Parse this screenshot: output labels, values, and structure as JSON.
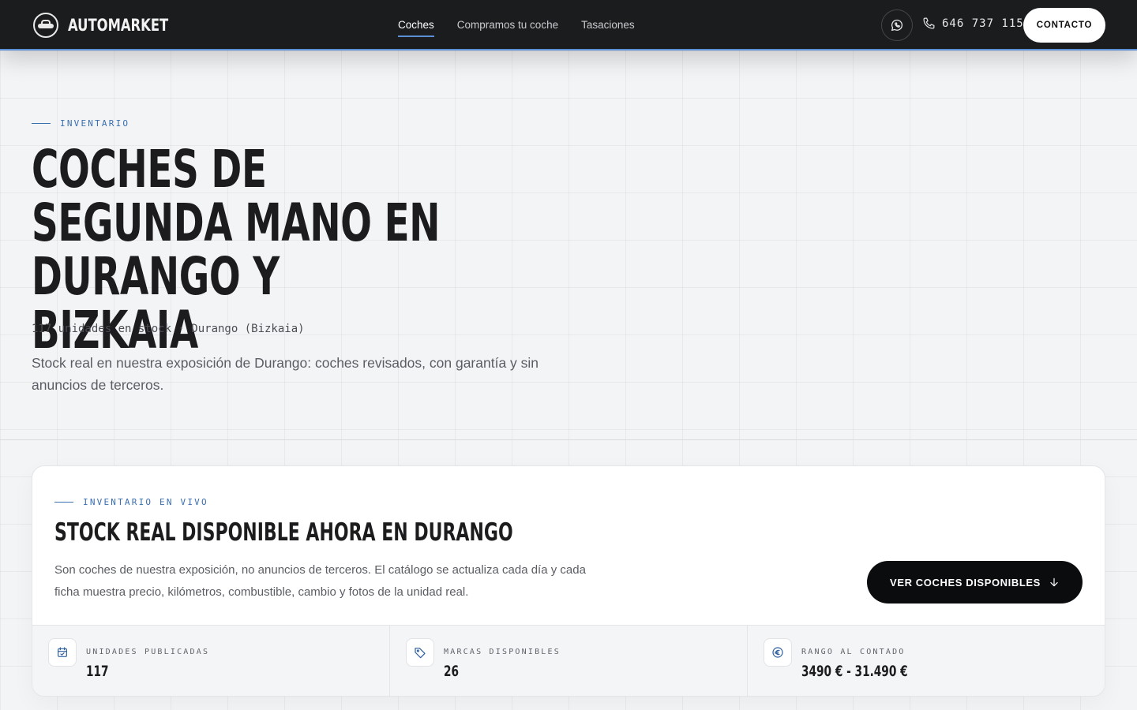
{
  "header": {
    "brand": "AUTOMARKET",
    "nav": [
      {
        "label": "Coches",
        "active": true
      },
      {
        "label": "Compramos tu coche",
        "active": false
      },
      {
        "label": "Tasaciones",
        "active": false
      }
    ],
    "phone": "646 737 115",
    "contact_label": "CONTACTO",
    "accent_color": "#5b8fd6"
  },
  "hero": {
    "eyebrow": "INVENTARIO",
    "title_lines": [
      "COCHES DE",
      "SEGUNDA MANO EN",
      "DURANGO Y BIZKAIA"
    ],
    "meta": "117 unidades en stock · Durango (Bizkaia)",
    "description": "Stock real en nuestra exposición de Durango: coches revisados, con garantía y sin anuncios de terceros."
  },
  "inventory": {
    "eyebrow": "INVENTARIO EN VIVO",
    "title": "STOCK REAL DISPONIBLE AHORA EN DURANGO",
    "description": "Son coches de nuestra exposición, no anuncios de terceros. El catálogo se actualiza cada día y cada ficha muestra precio, kilómetros, combustible, cambio y fotos de la unidad real.",
    "cta_label": "VER COCHES DISPONIBLES",
    "stats": [
      {
        "icon": "calendar-icon",
        "label": "UNIDADES PUBLICADAS",
        "value": "117"
      },
      {
        "icon": "tag-icon",
        "label": "MARCAS DISPONIBLES",
        "value": "26"
      },
      {
        "icon": "euro-icon",
        "label": "RANGO AL CONTADO",
        "value": "3490 € - 31.490 €"
      }
    ]
  }
}
